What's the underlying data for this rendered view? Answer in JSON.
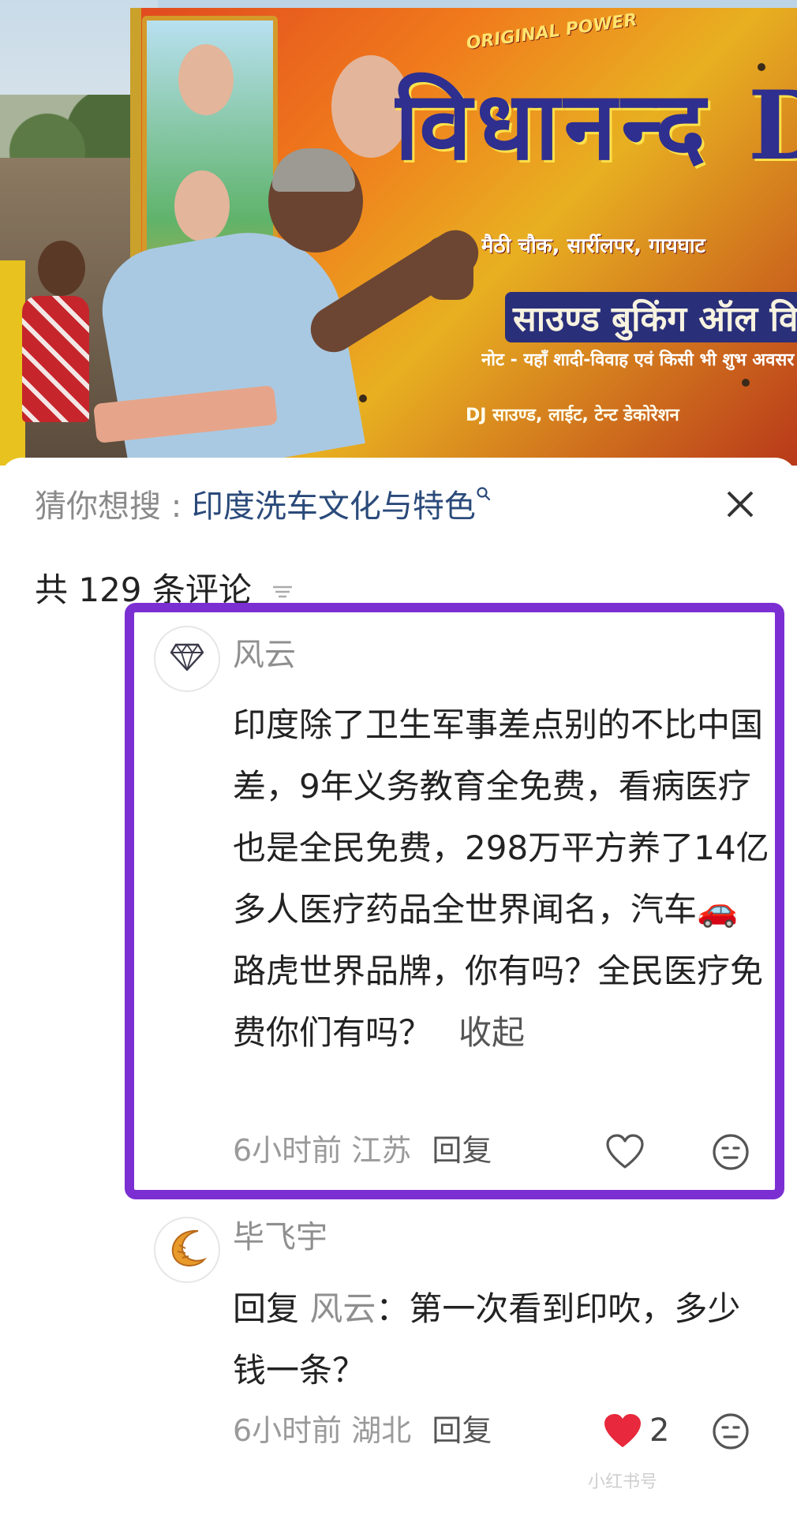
{
  "photo": {
    "banner_title": "विधानन्द DJ",
    "banner_power": "ORIGINAL POWER",
    "banner_lines": [
      "मैठी चौक, सार्रीलपर, गायघाट",
      "साउण्ड बुकिंग ऑल वि",
      "नोट - यहाँ शादी-विवाह एवं किसी भी शुभ अवसर",
      "DJ साउण्ड, लाईट, टेन्ट डेकोरेशन"
    ]
  },
  "search_suggestion": {
    "prefix": "猜你想搜 : ",
    "term": "印度洗车文化与特色",
    "search_icon": "search-icon",
    "close_icon": "close-icon"
  },
  "comments_header": {
    "count_text": "共 129 条评论",
    "sort_icon": "sort-icon"
  },
  "comments": [
    {
      "username": "风云",
      "avatar_icon": "diamond-icon",
      "text": "印度除了卫生军事差点别的不比中国差，9年义务教育全免费，看病医疗也是全民免费，298万平方养了14亿多人医疗药品全世界闻名，汽车🚗路虎世界品牌，你有吗？全民医疗免费你们有吗？",
      "collapse_label": "收起",
      "time": "6小时前",
      "location": "江苏",
      "reply_label": "回复",
      "liked": false,
      "emoji_icon": "emoji-icon",
      "highlight_color": "#7b2fd2"
    },
    {
      "username": "毕飞宇",
      "avatar_icon": "croissant-icon",
      "reply_prefix": "回复",
      "reply_to": "风云",
      "text": "：第一次看到印吹，多少钱一条？",
      "time": "6小时前",
      "location": "湖北",
      "reply_label": "回复",
      "liked": true,
      "like_count": "2",
      "like_color": "#e8283c",
      "emoji_icon": "emoji-icon"
    }
  ],
  "watermark": "小红书号"
}
